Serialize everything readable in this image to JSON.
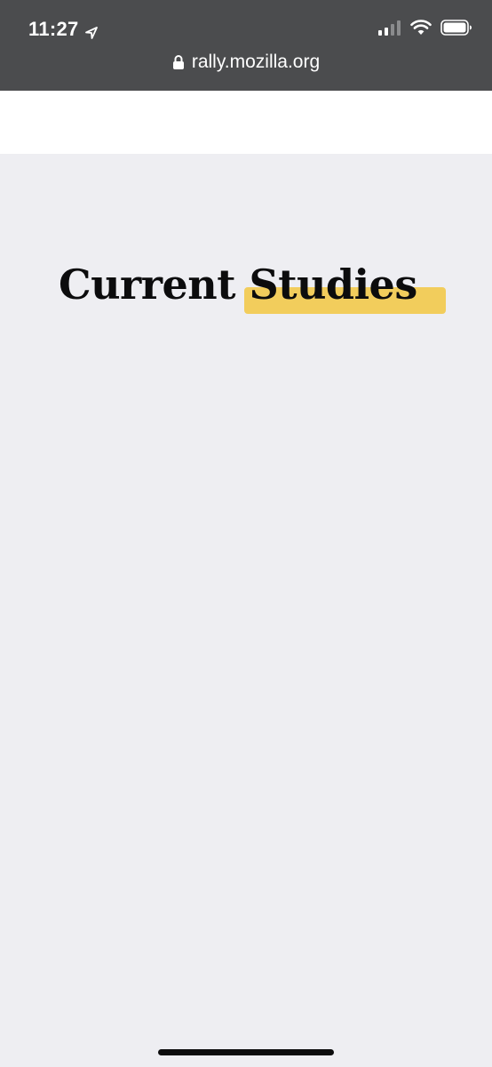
{
  "status_bar": {
    "time": "11:27",
    "icons": [
      "location-arrow-icon",
      "cellular-signal-icon",
      "wifi-icon",
      "battery-icon"
    ]
  },
  "browser": {
    "url": "rally.mozilla.org",
    "url_icon": "lock-icon"
  },
  "main": {
    "title": "Current Studies"
  },
  "colors": {
    "status_bar_bg": "#4b4c4e",
    "page_bg": "#eeeef2",
    "header_bg": "#ffffff",
    "highlight": "#f2cd5c",
    "title_text": "#0c0c0d"
  }
}
